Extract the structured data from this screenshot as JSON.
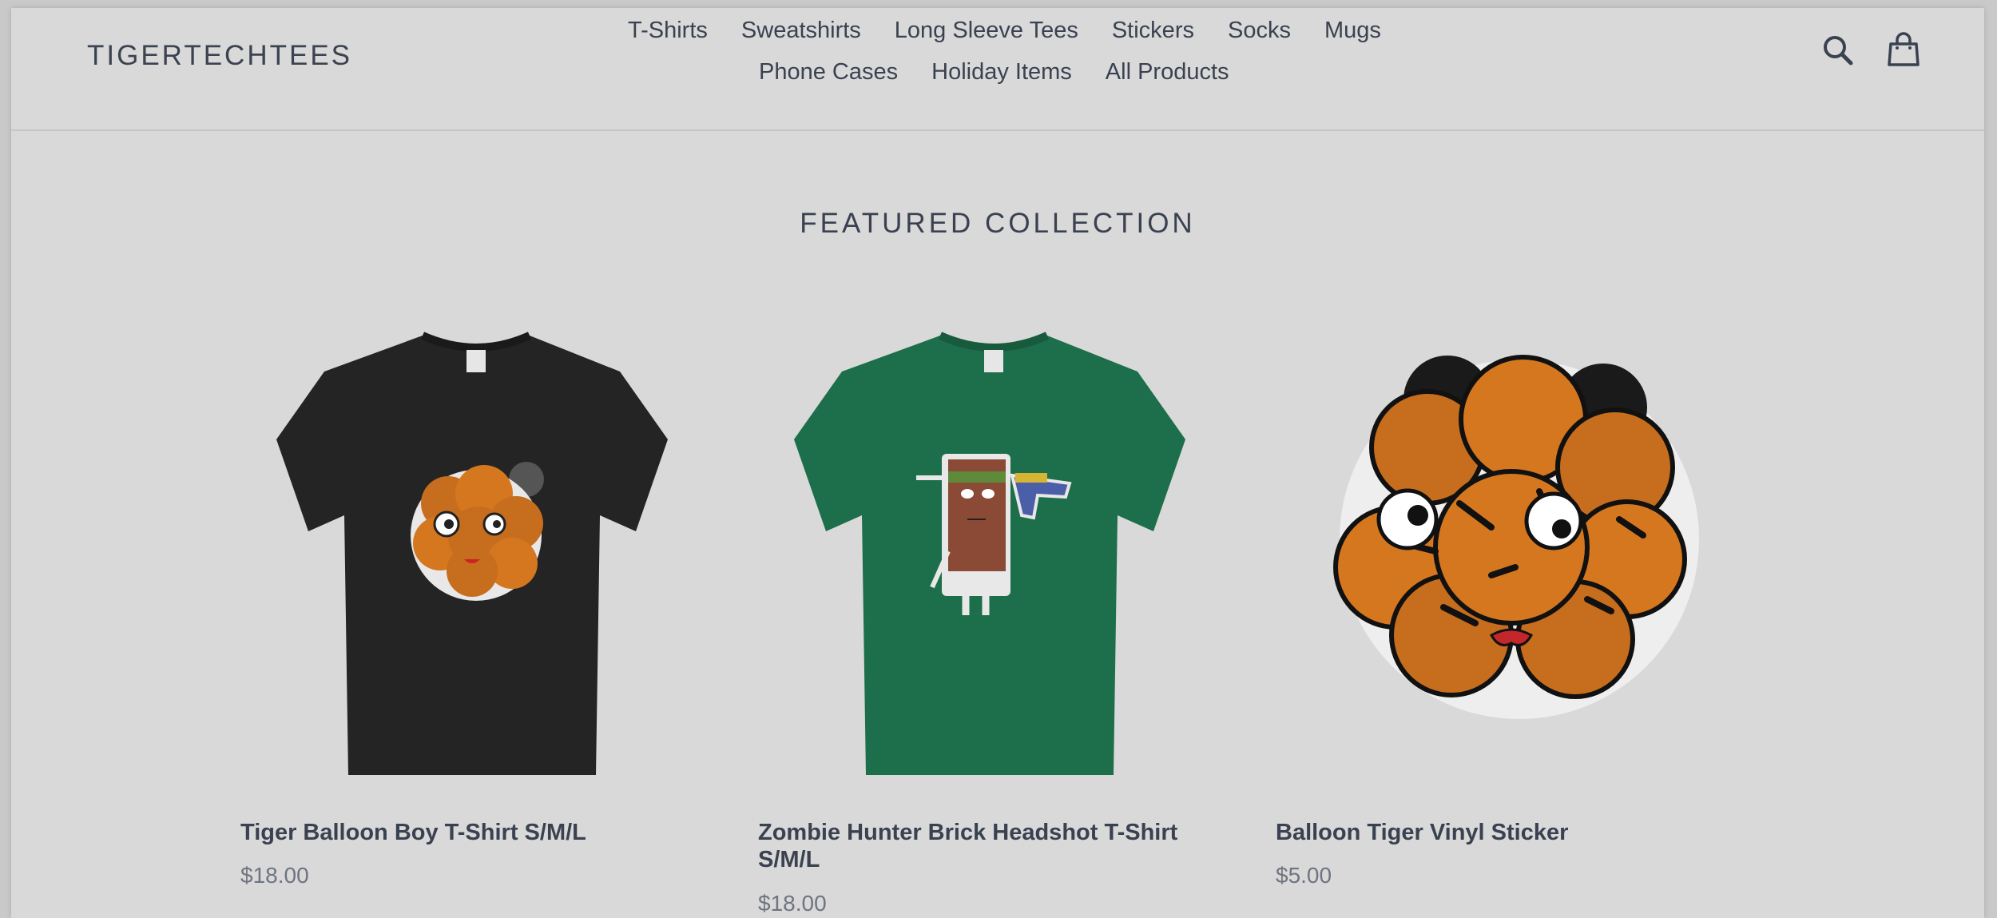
{
  "header": {
    "logo": "TIGERTECHTEES",
    "nav_row1": [
      "T-Shirts",
      "Sweatshirts",
      "Long Sleeve Tees",
      "Stickers",
      "Socks",
      "Mugs"
    ],
    "nav_row2": [
      "Phone Cases",
      "Holiday Items",
      "All Products"
    ],
    "icons": [
      "search-icon",
      "cart-icon"
    ]
  },
  "main": {
    "section_title": "FEATURED COLLECTION",
    "products": [
      {
        "title": "Tiger Balloon Boy T-Shirt S/M/L",
        "price": "$18.00",
        "shirt_color": "#242424"
      },
      {
        "title": "Zombie Hunter Brick Headshot T-Shirt S/M/L",
        "price": "$18.00",
        "shirt_color": "#1d6e4a"
      },
      {
        "title": "Balloon Tiger Vinyl Sticker",
        "price": "$5.00"
      }
    ]
  },
  "colors": {
    "background": "#d9d9d9",
    "text": "#3a4150",
    "price": "#6e7480",
    "tiger_orange": "#d5771f"
  }
}
